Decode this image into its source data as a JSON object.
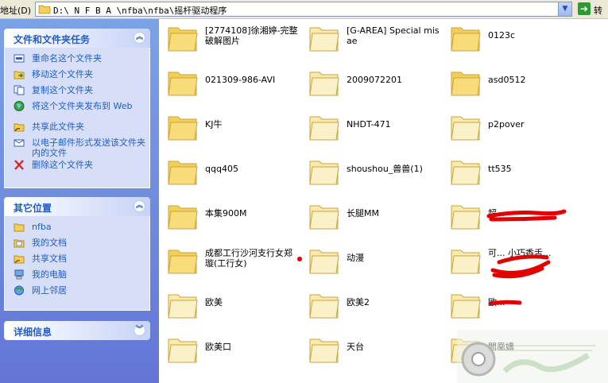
{
  "address_bar": {
    "label": "地址(D)",
    "path": "D:\\ N F B A \\nfba\\nfba\\摇杆驱动程序",
    "go_label": "转到"
  },
  "task_pane": {
    "file_tasks": {
      "title": "文件和文件夹任务",
      "collapse_icon": "chevron-up",
      "items": [
        {
          "label": "重命名这个文件夹",
          "icon": "rename-icon"
        },
        {
          "label": "移动这个文件夹",
          "icon": "move-icon"
        },
        {
          "label": "复制这个文件夹",
          "icon": "copy-icon"
        },
        {
          "label": "将这个文件夹发布到 Web",
          "icon": "publish-web-icon"
        },
        {
          "label": "共享此文件夹",
          "icon": "share-icon"
        },
        {
          "label": "以电子邮件形式发送该文件夹内的文件",
          "icon": "email-icon"
        },
        {
          "label": "删除这个文件夹",
          "icon": "delete-icon"
        }
      ]
    },
    "other_places": {
      "title": "其它位置",
      "collapse_icon": "chevron-up",
      "items": [
        {
          "label": "nfba",
          "icon": "folder-icon"
        },
        {
          "label": "我的文档",
          "icon": "my-documents-icon"
        },
        {
          "label": "共享文档",
          "icon": "shared-documents-icon"
        },
        {
          "label": "我的电脑",
          "icon": "my-computer-icon"
        },
        {
          "label": "网上邻居",
          "icon": "network-icon"
        }
      ]
    },
    "details": {
      "title": "详细信息",
      "collapse_icon": "chevron-down"
    }
  },
  "folders": [
    {
      "name": "[2774108]徐湘婷-完整破解图片"
    },
    {
      "name": "[G-AREA] Special misae"
    },
    {
      "name": "0123c"
    },
    {
      "name": "021309-986-AVI"
    },
    {
      "name": "2009072201"
    },
    {
      "name": "asd0512"
    },
    {
      "name": "KJ牛"
    },
    {
      "name": "NHDT-471"
    },
    {
      "name": "p2pover"
    },
    {
      "name": "qqq405"
    },
    {
      "name": "shoushou_兽兽(1)"
    },
    {
      "name": "tt535"
    },
    {
      "name": "本集900M"
    },
    {
      "name": "长腿MM"
    },
    {
      "name": "超..."
    },
    {
      "name": "成都工行沙河支行女郑璇(工行女)"
    },
    {
      "name": "动漫"
    },
    {
      "name": "可... 小巧香舌..."
    },
    {
      "name": "欧美"
    },
    {
      "name": "欧美2"
    },
    {
      "name": "欧..."
    },
    {
      "name": "欧美口"
    },
    {
      "name": "天台"
    },
    {
      "name": "閻凰嬌"
    }
  ],
  "colors": {
    "task_pane_bg": "#6f8fe0",
    "panel_title": "#215dc6",
    "folder_yellow": "#f4d76a",
    "scribble_red": "#e00000"
  }
}
